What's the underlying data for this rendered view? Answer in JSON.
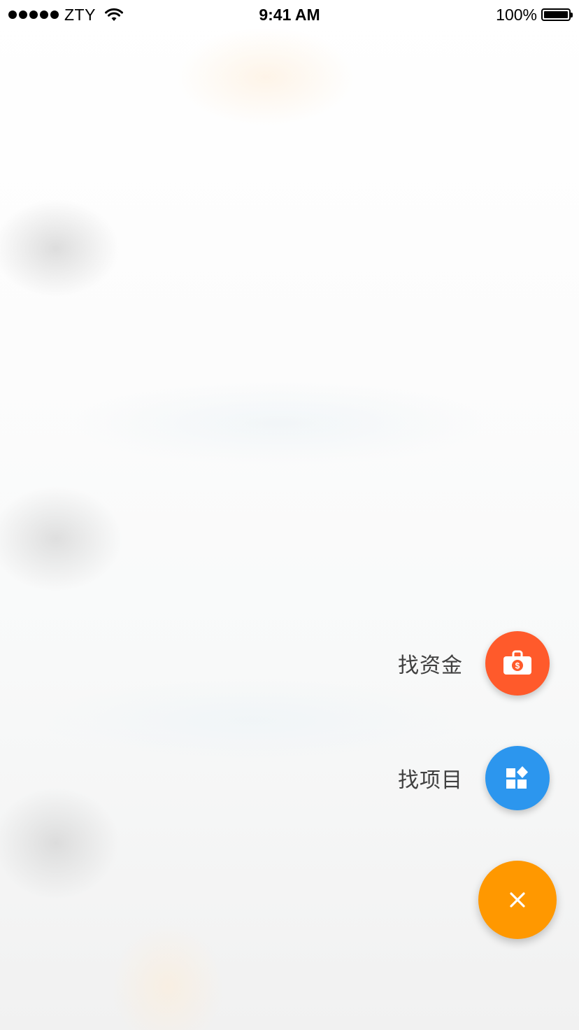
{
  "status_bar": {
    "carrier": "ZTY",
    "time": "9:41 AM",
    "battery": "100%",
    "icons": [
      "signal-dots-icon",
      "wifi-icon",
      "battery-icon"
    ]
  },
  "fab_menu": {
    "items": [
      {
        "label": "找资金",
        "icon": "money-briefcase-icon",
        "color": "#ff5a2b"
      },
      {
        "label": "找项目",
        "icon": "shapes-grid-icon",
        "color": "#2c96ee"
      }
    ],
    "close_button": {
      "icon": "close-icon",
      "color": "#ff9800"
    }
  }
}
